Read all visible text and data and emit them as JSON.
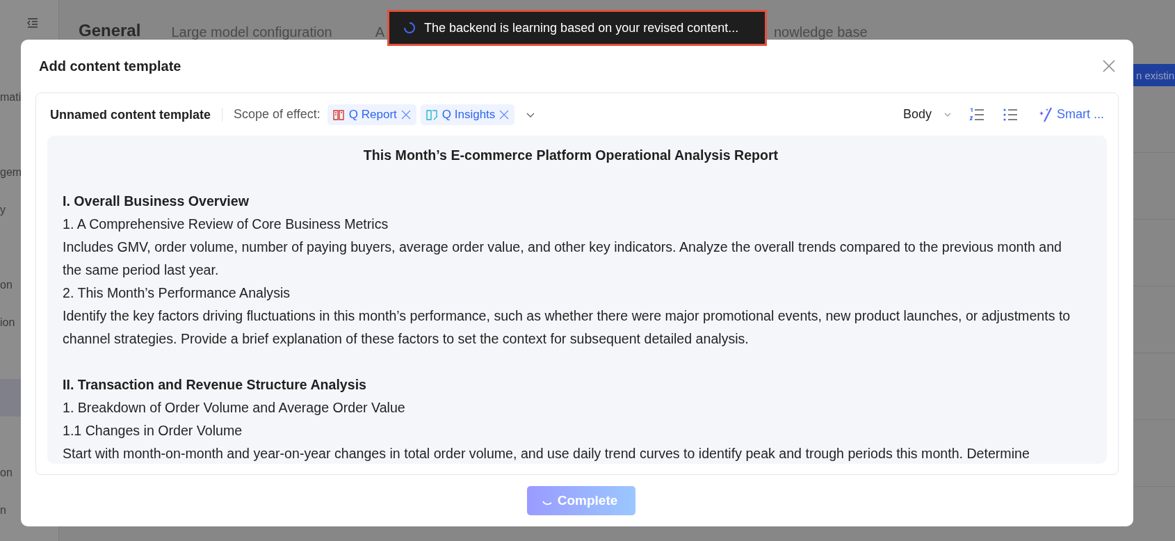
{
  "background_page": {
    "sidebar": {
      "items": [
        {
          "label": "mati",
          "selected": false
        },
        {
          "label": "gem",
          "selected": false
        },
        {
          "label": "y",
          "selected": false
        },
        {
          "label": "on",
          "selected": false
        },
        {
          "label": "ion",
          "selected": false
        },
        {
          "selected": true
        },
        {
          "label": "on",
          "selected": false
        },
        {
          "label": "n",
          "selected": false
        }
      ]
    },
    "tabs": [
      {
        "label": "General",
        "selected": true
      },
      {
        "label": "Large model configuration",
        "selected": false
      },
      {
        "label": "A",
        "selected": false
      },
      {
        "label": "nowledge base",
        "selected": false
      }
    ],
    "action_button": "n existin"
  },
  "toast": {
    "message": "The backend is learning based on your revised content...",
    "loading": true
  },
  "dialog": {
    "title": "Add content template",
    "template_name": "Unnamed content template",
    "scope_label": "Scope of effect:",
    "scope_tags": [
      {
        "label": "Q Report",
        "kind": "report"
      },
      {
        "label": "Q Insights",
        "kind": "insights"
      }
    ],
    "text_style": "Body",
    "smart_button": "Smart ...",
    "document": {
      "title": "This Month’s E-commerce Platform Operational Analysis Report",
      "blocks": [
        {
          "kind": "heading",
          "text": "I. Overall Business Overview"
        },
        {
          "kind": "paragraph",
          "text": "1. A Comprehensive Review of Core Business Metrics"
        },
        {
          "kind": "paragraph",
          "text": "Includes GMV, order volume, number of paying buyers, average order value, and other key indicators. Analyze the overall trends compared to the previous month and the same period last year."
        },
        {
          "kind": "paragraph",
          "text": "2. This Month’s Performance Analysis"
        },
        {
          "kind": "paragraph",
          "text": "Identify the key factors driving fluctuations in this month’s performance, such as whether there were major promotional events, new product launches, or adjustments to channel strategies. Provide a brief explanation of these factors to set the context for subsequent detailed analysis."
        },
        {
          "kind": "heading",
          "text": "II. Transaction and Revenue Structure Analysis"
        },
        {
          "kind": "paragraph",
          "text": "1. Breakdown of Order Volume and Average Order Value"
        },
        {
          "kind": "paragraph",
          "text": "1.1 Changes in Order Volume"
        },
        {
          "kind": "paragraph",
          "text": "Start with month-on-month and year-on-year changes in total order volume, and use daily trend curves to identify peak and trough periods this month. Determine"
        }
      ]
    },
    "complete_button": {
      "label": "Complete",
      "loading": true
    }
  }
}
